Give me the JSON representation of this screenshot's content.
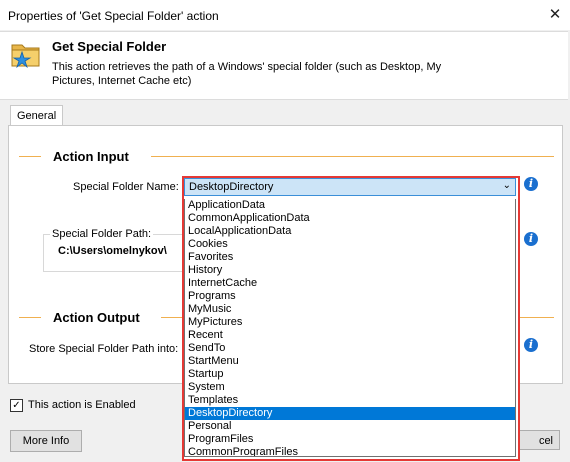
{
  "window": {
    "title": "Properties of 'Get Special Folder' action",
    "close_glyph": "✕"
  },
  "header": {
    "title": "Get Special Folder",
    "description": "This action retrieves the path of a Windows' special folder (such as Desktop, My Pictures, Internet Cache etc)"
  },
  "tabs": [
    {
      "label": "General"
    }
  ],
  "input_section": {
    "label": "Action Input"
  },
  "output_section": {
    "label": "Action Output"
  },
  "special_folder_name": {
    "label": "Special Folder Name:",
    "value": "DesktopDirectory"
  },
  "special_folder_path": {
    "label": "Special Folder Path:",
    "value": "C:\\Users\\omelnykov\\"
  },
  "store_into": {
    "label": "Store Special Folder Path into:"
  },
  "enabled": {
    "label": "This action is Enabled",
    "checked": true
  },
  "buttons": {
    "more_info": "More Info",
    "cancel_partial": "cel"
  },
  "dropdown": {
    "items": [
      "ApplicationData",
      "CommonApplicationData",
      "LocalApplicationData",
      "Cookies",
      "Favorites",
      "History",
      "InternetCache",
      "Programs",
      "MyMusic",
      "MyPictures",
      "Recent",
      "SendTo",
      "StartMenu",
      "Startup",
      "System",
      "Templates",
      "DesktopDirectory",
      "Personal",
      "ProgramFiles",
      "CommonProgramFiles"
    ],
    "selected": "DesktopDirectory"
  },
  "icons": {
    "header": "folder-star-icon",
    "info": "info-icon",
    "dropdown_arrow": "chevron-down-icon",
    "checkbox_glyph": "✓",
    "info_glyph": "i",
    "arrow_glyph": "⌄"
  },
  "colors": {
    "selection": "#0078d7",
    "highlight_border": "#e53935",
    "section_line": "#f0b050",
    "info": "#1a6fcf"
  }
}
